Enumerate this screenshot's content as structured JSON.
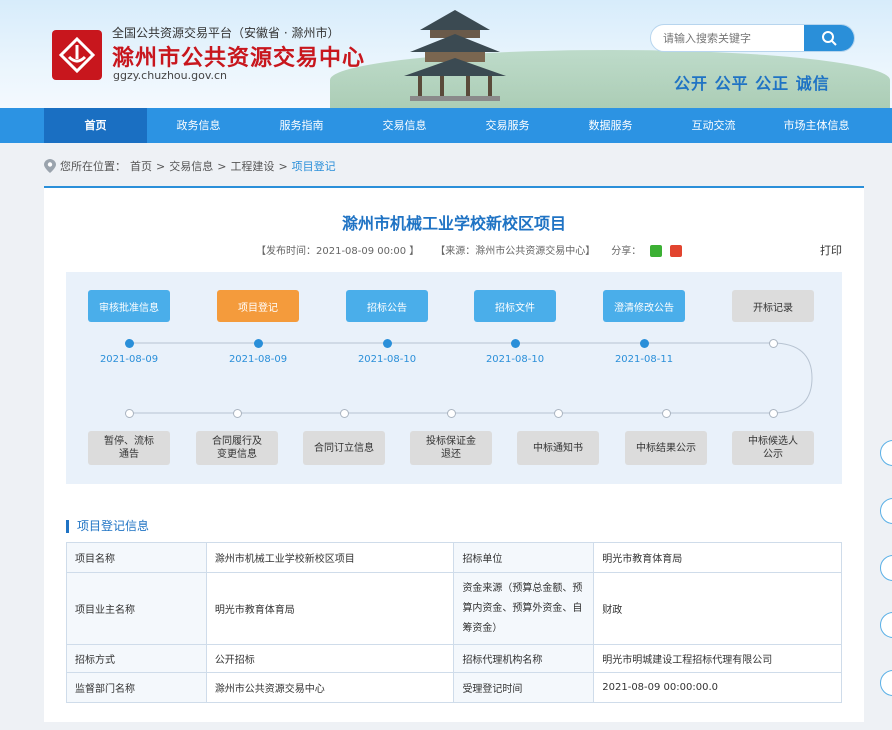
{
  "header": {
    "platform": "全国公共资源交易平台（安徽省 · 滁州市）",
    "site_name": "滁州市公共资源交易中心",
    "url": "ggzy.chuzhou.gov.cn",
    "search_placeholder": "请输入搜索关键字",
    "slogan": "公开 公平 公正 诚信"
  },
  "nav": {
    "items": [
      {
        "label": "首页",
        "active": true
      },
      {
        "label": "政务信息"
      },
      {
        "label": "服务指南"
      },
      {
        "label": "交易信息"
      },
      {
        "label": "交易服务"
      },
      {
        "label": "数据服务"
      },
      {
        "label": "互动交流"
      },
      {
        "label": "市场主体信息"
      }
    ]
  },
  "breadcrumb": {
    "prefix": "您所在位置：",
    "items": [
      "首页",
      "交易信息",
      "工程建设",
      "项目登记"
    ],
    "separator": ">"
  },
  "article": {
    "title": "滁州市机械工业学校新校区项目",
    "publish_time": "【发布时间：2021-08-09 00:00 】",
    "source": "【来源：滁州市公共资源交易中心】",
    "share_label": "分享：",
    "print_label": "打印"
  },
  "process": {
    "top_steps": [
      {
        "label": "审核批准信息",
        "date": "2021-08-09",
        "style": "blue"
      },
      {
        "label": "项目登记",
        "date": "2021-08-09",
        "style": "orange"
      },
      {
        "label": "招标公告",
        "date": "2021-08-10",
        "style": "blue"
      },
      {
        "label": "招标文件",
        "date": "2021-08-10",
        "style": "blue"
      },
      {
        "label": "澄清修改公告",
        "date": "2021-08-11",
        "style": "blue"
      },
      {
        "label": "开标记录",
        "date": "",
        "style": "gray"
      }
    ],
    "bottom_steps": [
      {
        "line1": "暂停、流标",
        "line2": "通告"
      },
      {
        "line1": "合同履行及",
        "line2": "变更信息"
      },
      {
        "line1": "合同订立信息",
        "line2": ""
      },
      {
        "line1": "投标保证金",
        "line2": "退还"
      },
      {
        "line1": "中标通知书",
        "line2": ""
      },
      {
        "line1": "中标结果公示",
        "line2": ""
      },
      {
        "line1": "中标候选人",
        "line2": "公示"
      }
    ]
  },
  "info": {
    "section_title": "项目登记信息",
    "rows": [
      {
        "k1": "项目名称",
        "v1": "滁州市机械工业学校新校区项目",
        "k2": "招标单位",
        "v2": "明光市教育体育局"
      },
      {
        "k1": "项目业主名称",
        "v1": "明光市教育体育局",
        "k2": "资金来源（预算总金额、预算内资金、预算外资金、自筹资金）",
        "v2": "财政"
      },
      {
        "k1": "招标方式",
        "v1": "公开招标",
        "k2": "招标代理机构名称",
        "v2": "明光市明城建设工程招标代理有限公司"
      },
      {
        "k1": "监督部门名称",
        "v1": "滁州市公共资源交易中心",
        "k2": "受理登记时间",
        "v2": "2021-08-09 00:00:00.0"
      }
    ]
  },
  "colors": {
    "primary": "#2c93e3",
    "accent_red": "#c8161d",
    "active_step": "#f49b3c"
  }
}
